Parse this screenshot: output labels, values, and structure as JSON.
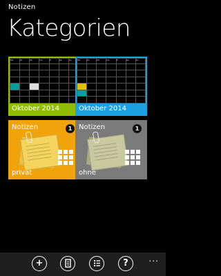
{
  "app": {
    "title": "Notizen"
  },
  "page": {
    "title": "Kategorien"
  },
  "tiles": {
    "calendar_a": {
      "label": "Oktober 2014",
      "weekdays": [
        "Mo",
        "Di",
        "Mi",
        "Do",
        "Fr",
        "Sa",
        "So"
      ],
      "color": "#8fbe00"
    },
    "calendar_b": {
      "label": "Oktober 2014",
      "weekdays": [
        "Mo",
        "Di",
        "Mi",
        "Do",
        "Fr",
        "Sa",
        "So"
      ],
      "color": "#1ba1e2"
    },
    "note_private": {
      "title": "Notizen",
      "count": "1",
      "label": "privat",
      "color": "#f0a30a"
    },
    "note_none": {
      "title": "Notizen",
      "count": "1",
      "label": "ohne",
      "color": "#7a7a7a"
    }
  },
  "appbar": {
    "icons": [
      "add-icon",
      "notebook-icon",
      "list-icon",
      "help-icon",
      "more-icon"
    ],
    "add": "+",
    "help": "?",
    "more": "..."
  }
}
